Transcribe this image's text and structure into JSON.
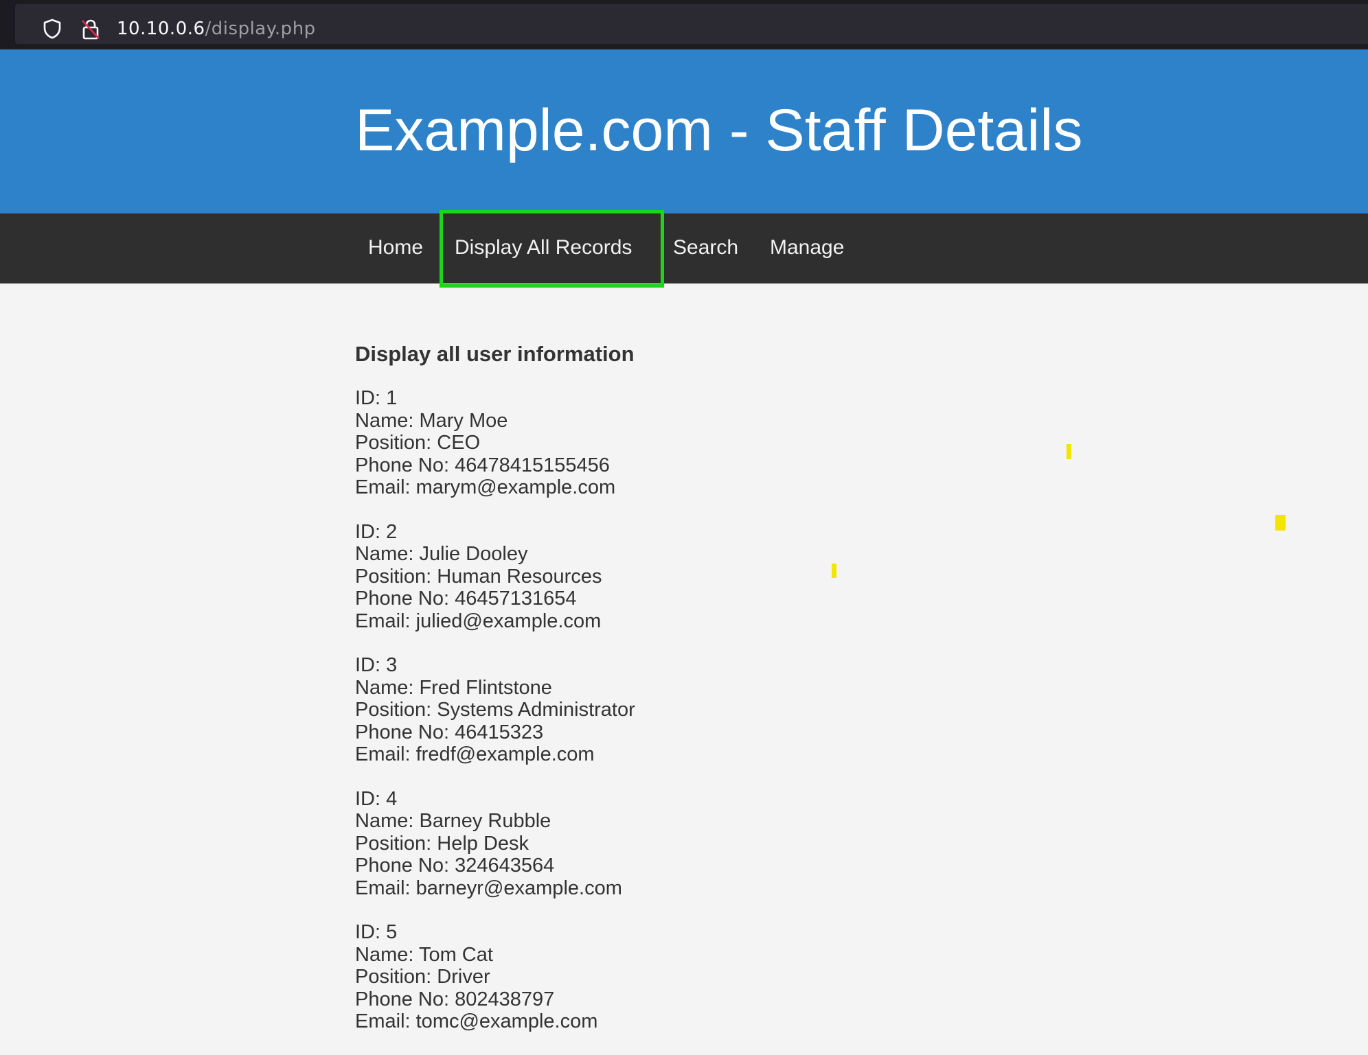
{
  "browser": {
    "url_host": "10.10.0.6",
    "url_path": "/display.php",
    "icons": [
      "shield-icon",
      "lock-insecure-icon"
    ]
  },
  "header": {
    "title": "Example.com - Staff Details",
    "background_color": "#2e82c9"
  },
  "nav": {
    "items": [
      {
        "label": "Home"
      },
      {
        "label": "Display All Records",
        "highlighted": true
      },
      {
        "label": "Search"
      },
      {
        "label": "Manage"
      }
    ],
    "highlight_color": "#1ed51e"
  },
  "main": {
    "heading": "Display all user information",
    "records": [
      {
        "id": "ID: 1",
        "name": "Name: Mary Moe",
        "position": "Position: CEO",
        "phone": "Phone No: 46478415155456",
        "email": "Email: marym@example.com"
      },
      {
        "id": "ID: 2",
        "name": "Name: Julie Dooley",
        "position": "Position: Human Resources",
        "phone": "Phone No: 46457131654",
        "email": "Email: julied@example.com"
      },
      {
        "id": "ID: 3",
        "name": "Name: Fred Flintstone",
        "position": "Position: Systems Administrator",
        "phone": "Phone No: 46415323",
        "email": "Email: fredf@example.com"
      },
      {
        "id": "ID: 4",
        "name": "Name: Barney Rubble",
        "position": "Position: Help Desk",
        "phone": "Phone No: 324643564",
        "email": "Email: barneyr@example.com"
      },
      {
        "id": "ID: 5",
        "name": "Name: Tom Cat",
        "position": "Position: Driver",
        "phone": "Phone No: 802438797",
        "email": "Email: tomc@example.com"
      }
    ]
  }
}
